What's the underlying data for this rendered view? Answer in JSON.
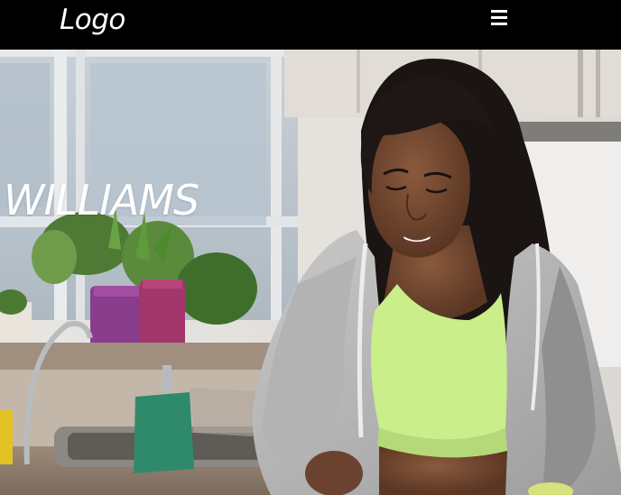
{
  "header": {
    "logo_text": "Logo",
    "menu_icon": "hamburger-menu-icon"
  },
  "hero": {
    "title": "WILLIAMS"
  }
}
